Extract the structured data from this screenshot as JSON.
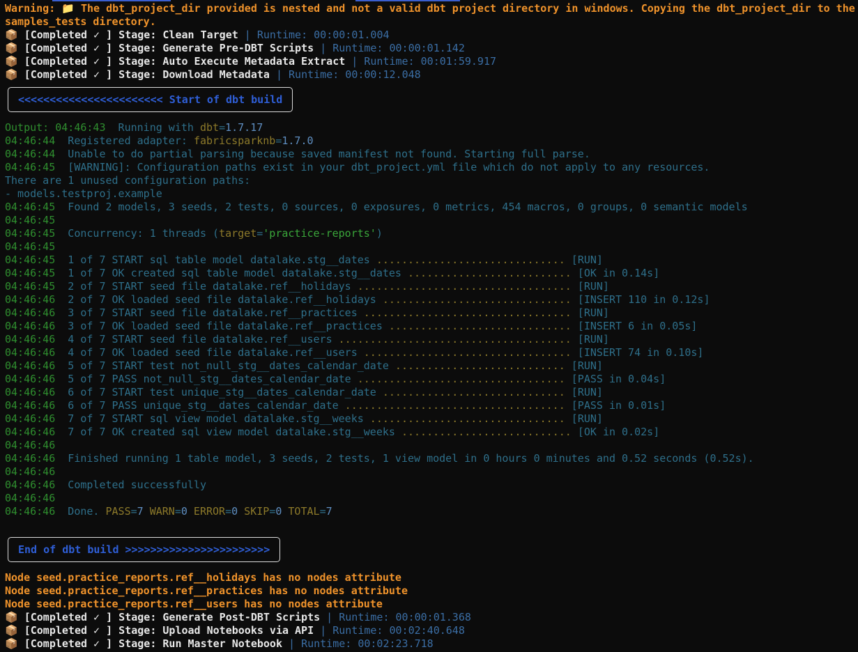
{
  "header_warning": {
    "line1": "Warning: 📁 The dbt_project_dir provided is nested and not a valid dbt project directory in windows. Copying the dbt_project_dir to the",
    "line2": "samples_tests directory."
  },
  "pre_stages": [
    {
      "label": "📦 [Completed ✓ ] Stage: Clean Target",
      "sep": " | ",
      "runtime": "Runtime: 00:00:01.004"
    },
    {
      "label": "📦 [Completed ✓ ] Stage: Generate Pre-DBT Scripts",
      "sep": " | ",
      "runtime": "Runtime: 00:00:01.142"
    },
    {
      "label": "📦 [Completed ✓ ] Stage: Auto Execute Metadata Extract",
      "sep": " | ",
      "runtime": "Runtime: 00:01:59.917"
    },
    {
      "label": "📦 [Completed ✓ ] Stage: Download Metadata",
      "sep": " | ",
      "runtime": "Runtime: 00:00:12.048"
    }
  ],
  "start_banner": "<<<<<<<<<<<<<<<<<<<<<<< Start of dbt build",
  "end_banner": "End of dbt build >>>>>>>>>>>>>>>>>>>>>>>",
  "dbt_log": {
    "output_prefix": "Output: ",
    "output_time": "04:46:43",
    "output_text": "  Running with ",
    "output_key": "dbt",
    "output_eq": "=",
    "output_val": "1.7.17",
    "registered_time": "04:46:44",
    "registered_text": "  Registered adapter: ",
    "registered_key": "fabricsparknb",
    "registered_eq": "=",
    "registered_val": "1.7.0",
    "partial_time": "04:46:44",
    "partial_text": "  Unable to do partial parsing because saved manifest not found. Starting full parse.",
    "warning_time": "04:46:45",
    "warning_text": "  [WARNING]: Configuration paths exist in your dbt_project.yml file which do not apply to any resources.",
    "unused_line": "There are 1 unused configuration paths:",
    "unused_item": "- models.testproj.example",
    "found_time": "04:46:45",
    "found_text": "  Found 2 models, 3 seeds, 2 tests, 0 sources, 0 exposures, 0 metrics, 454 macros, 0 groups, 0 semantic models",
    "blank1_time": "04:46:45",
    "conc_time": "04:46:45",
    "conc_text": "  Concurrency: 1 threads (",
    "conc_key": "target",
    "conc_eq": "=",
    "conc_val": "'practice-reports'",
    "conc_close": ")",
    "blank2_time": "04:46:45"
  },
  "steps": [
    {
      "time": "04:46:45",
      "text": "  1 of 7 START sql table model datalake.stg__dates ",
      "dots": "..............................",
      "status": " [RUN]"
    },
    {
      "time": "04:46:45",
      "text": "  1 of 7 OK created sql table model datalake.stg__dates ",
      "dots": "..........................",
      "status": " [OK in 0.14s]"
    },
    {
      "time": "04:46:45",
      "text": "  2 of 7 START seed file datalake.ref__holidays ",
      "dots": "..................................",
      "status": " [RUN]"
    },
    {
      "time": "04:46:46",
      "text": "  2 of 7 OK loaded seed file datalake.ref__holidays ",
      "dots": "..............................",
      "status": " [INSERT 110 in 0.12s]"
    },
    {
      "time": "04:46:46",
      "text": "  3 of 7 START seed file datalake.ref__practices ",
      "dots": ".................................",
      "status": " [RUN]"
    },
    {
      "time": "04:46:46",
      "text": "  3 of 7 OK loaded seed file datalake.ref__practices ",
      "dots": ".............................",
      "status": " [INSERT 6 in 0.05s]"
    },
    {
      "time": "04:46:46",
      "text": "  4 of 7 START seed file datalake.ref__users ",
      "dots": ".....................................",
      "status": " [RUN]"
    },
    {
      "time": "04:46:46",
      "text": "  4 of 7 OK loaded seed file datalake.ref__users ",
      "dots": ".................................",
      "status": " [INSERT 74 in 0.10s]"
    },
    {
      "time": "04:46:46",
      "text": "  5 of 7 START test not_null_stg__dates_calendar_date ",
      "dots": "...........................",
      "status": " [RUN]"
    },
    {
      "time": "04:46:46",
      "text": "  5 of 7 PASS not_null_stg__dates_calendar_date ",
      "dots": ".................................",
      "status": " [PASS in 0.04s]"
    },
    {
      "time": "04:46:46",
      "text": "  6 of 7 START test unique_stg__dates_calendar_date ",
      "dots": ".............................",
      "status": " [RUN]"
    },
    {
      "time": "04:46:46",
      "text": "  6 of 7 PASS unique_stg__dates_calendar_date ",
      "dots": "...................................",
      "status": " [PASS in 0.01s]"
    },
    {
      "time": "04:46:46",
      "text": "  7 of 7 START sql view model datalake.stg__weeks ",
      "dots": "...............................",
      "status": " [RUN]"
    },
    {
      "time": "04:46:46",
      "text": "  7 of 7 OK created sql view model datalake.stg__weeks ",
      "dots": "...........................",
      "status": " [OK in 0.02s]"
    }
  ],
  "summary": {
    "blank3_time": "04:46:46",
    "finished_time": "04:46:46",
    "finished_text": "  Finished running 1 table model, 3 seeds, 2 tests, 1 view model in 0 hours 0 minutes and 0.52 seconds (0.52s).",
    "blank4_time": "04:46:46",
    "completed_time": "04:46:46",
    "completed_text": "  Completed successfully",
    "blank5_time": "04:46:46",
    "done_time": "04:46:46",
    "done_text": "  Done. ",
    "pass_key": "PASS",
    "pass_val": "7",
    "warn_key": " WARN",
    "warn_val": "0",
    "error_key": " ERROR",
    "error_val": "0",
    "skip_key": " SKIP",
    "skip_val": "0",
    "total_key": " TOTAL",
    "total_val": "7",
    "eq": "="
  },
  "node_warnings": [
    "Node seed.practice_reports.ref__holidays has no nodes attribute",
    "Node seed.practice_reports.ref__practices has no nodes attribute",
    "Node seed.practice_reports.ref__users has no nodes attribute"
  ],
  "post_stages": [
    {
      "label": "📦 [Completed ✓ ] Stage: Generate Post-DBT Scripts",
      "sep": " | ",
      "runtime": "Runtime: 00:00:01.368"
    },
    {
      "label": "📦 [Completed ✓ ] Stage: Upload Notebooks via API",
      "sep": " | ",
      "runtime": "Runtime: 00:02:40.648"
    },
    {
      "label": "📦 [Completed ✓ ] Stage: Run Master Notebook",
      "sep": " | ",
      "runtime": "Runtime: 00:02:23.718"
    }
  ],
  "colors": {
    "background": "#0c0c0c",
    "warning": "#f0932b",
    "banner_text": "#2f5fd8",
    "timestamp": "#2f8f2f"
  }
}
